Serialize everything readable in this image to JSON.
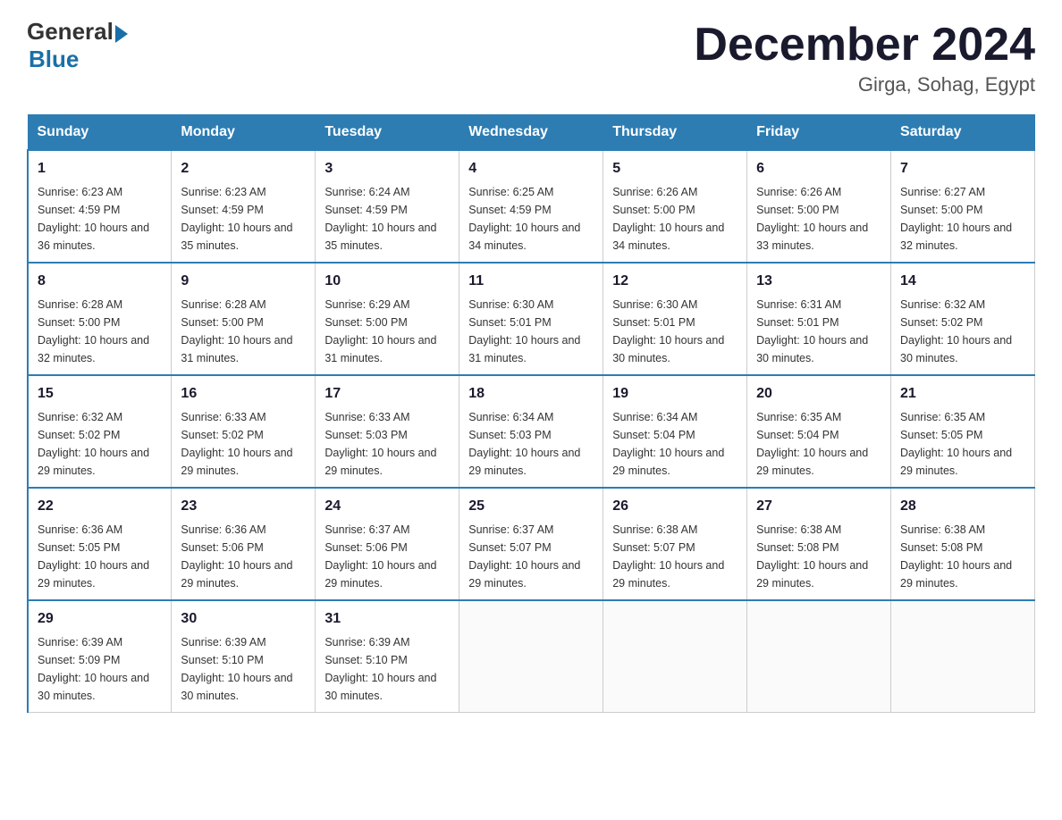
{
  "header": {
    "logo_general": "General",
    "logo_blue": "Blue",
    "month_title": "December 2024",
    "location": "Girga, Sohag, Egypt"
  },
  "days_of_week": [
    "Sunday",
    "Monday",
    "Tuesday",
    "Wednesday",
    "Thursday",
    "Friday",
    "Saturday"
  ],
  "weeks": [
    [
      {
        "num": "1",
        "sunrise": "6:23 AM",
        "sunset": "4:59 PM",
        "daylight": "10 hours and 36 minutes."
      },
      {
        "num": "2",
        "sunrise": "6:23 AM",
        "sunset": "4:59 PM",
        "daylight": "10 hours and 35 minutes."
      },
      {
        "num": "3",
        "sunrise": "6:24 AM",
        "sunset": "4:59 PM",
        "daylight": "10 hours and 35 minutes."
      },
      {
        "num": "4",
        "sunrise": "6:25 AM",
        "sunset": "4:59 PM",
        "daylight": "10 hours and 34 minutes."
      },
      {
        "num": "5",
        "sunrise": "6:26 AM",
        "sunset": "5:00 PM",
        "daylight": "10 hours and 34 minutes."
      },
      {
        "num": "6",
        "sunrise": "6:26 AM",
        "sunset": "5:00 PM",
        "daylight": "10 hours and 33 minutes."
      },
      {
        "num": "7",
        "sunrise": "6:27 AM",
        "sunset": "5:00 PM",
        "daylight": "10 hours and 32 minutes."
      }
    ],
    [
      {
        "num": "8",
        "sunrise": "6:28 AM",
        "sunset": "5:00 PM",
        "daylight": "10 hours and 32 minutes."
      },
      {
        "num": "9",
        "sunrise": "6:28 AM",
        "sunset": "5:00 PM",
        "daylight": "10 hours and 31 minutes."
      },
      {
        "num": "10",
        "sunrise": "6:29 AM",
        "sunset": "5:00 PM",
        "daylight": "10 hours and 31 minutes."
      },
      {
        "num": "11",
        "sunrise": "6:30 AM",
        "sunset": "5:01 PM",
        "daylight": "10 hours and 31 minutes."
      },
      {
        "num": "12",
        "sunrise": "6:30 AM",
        "sunset": "5:01 PM",
        "daylight": "10 hours and 30 minutes."
      },
      {
        "num": "13",
        "sunrise": "6:31 AM",
        "sunset": "5:01 PM",
        "daylight": "10 hours and 30 minutes."
      },
      {
        "num": "14",
        "sunrise": "6:32 AM",
        "sunset": "5:02 PM",
        "daylight": "10 hours and 30 minutes."
      }
    ],
    [
      {
        "num": "15",
        "sunrise": "6:32 AM",
        "sunset": "5:02 PM",
        "daylight": "10 hours and 29 minutes."
      },
      {
        "num": "16",
        "sunrise": "6:33 AM",
        "sunset": "5:02 PM",
        "daylight": "10 hours and 29 minutes."
      },
      {
        "num": "17",
        "sunrise": "6:33 AM",
        "sunset": "5:03 PM",
        "daylight": "10 hours and 29 minutes."
      },
      {
        "num": "18",
        "sunrise": "6:34 AM",
        "sunset": "5:03 PM",
        "daylight": "10 hours and 29 minutes."
      },
      {
        "num": "19",
        "sunrise": "6:34 AM",
        "sunset": "5:04 PM",
        "daylight": "10 hours and 29 minutes."
      },
      {
        "num": "20",
        "sunrise": "6:35 AM",
        "sunset": "5:04 PM",
        "daylight": "10 hours and 29 minutes."
      },
      {
        "num": "21",
        "sunrise": "6:35 AM",
        "sunset": "5:05 PM",
        "daylight": "10 hours and 29 minutes."
      }
    ],
    [
      {
        "num": "22",
        "sunrise": "6:36 AM",
        "sunset": "5:05 PM",
        "daylight": "10 hours and 29 minutes."
      },
      {
        "num": "23",
        "sunrise": "6:36 AM",
        "sunset": "5:06 PM",
        "daylight": "10 hours and 29 minutes."
      },
      {
        "num": "24",
        "sunrise": "6:37 AM",
        "sunset": "5:06 PM",
        "daylight": "10 hours and 29 minutes."
      },
      {
        "num": "25",
        "sunrise": "6:37 AM",
        "sunset": "5:07 PM",
        "daylight": "10 hours and 29 minutes."
      },
      {
        "num": "26",
        "sunrise": "6:38 AM",
        "sunset": "5:07 PM",
        "daylight": "10 hours and 29 minutes."
      },
      {
        "num": "27",
        "sunrise": "6:38 AM",
        "sunset": "5:08 PM",
        "daylight": "10 hours and 29 minutes."
      },
      {
        "num": "28",
        "sunrise": "6:38 AM",
        "sunset": "5:08 PM",
        "daylight": "10 hours and 29 minutes."
      }
    ],
    [
      {
        "num": "29",
        "sunrise": "6:39 AM",
        "sunset": "5:09 PM",
        "daylight": "10 hours and 30 minutes."
      },
      {
        "num": "30",
        "sunrise": "6:39 AM",
        "sunset": "5:10 PM",
        "daylight": "10 hours and 30 minutes."
      },
      {
        "num": "31",
        "sunrise": "6:39 AM",
        "sunset": "5:10 PM",
        "daylight": "10 hours and 30 minutes."
      },
      null,
      null,
      null,
      null
    ]
  ]
}
